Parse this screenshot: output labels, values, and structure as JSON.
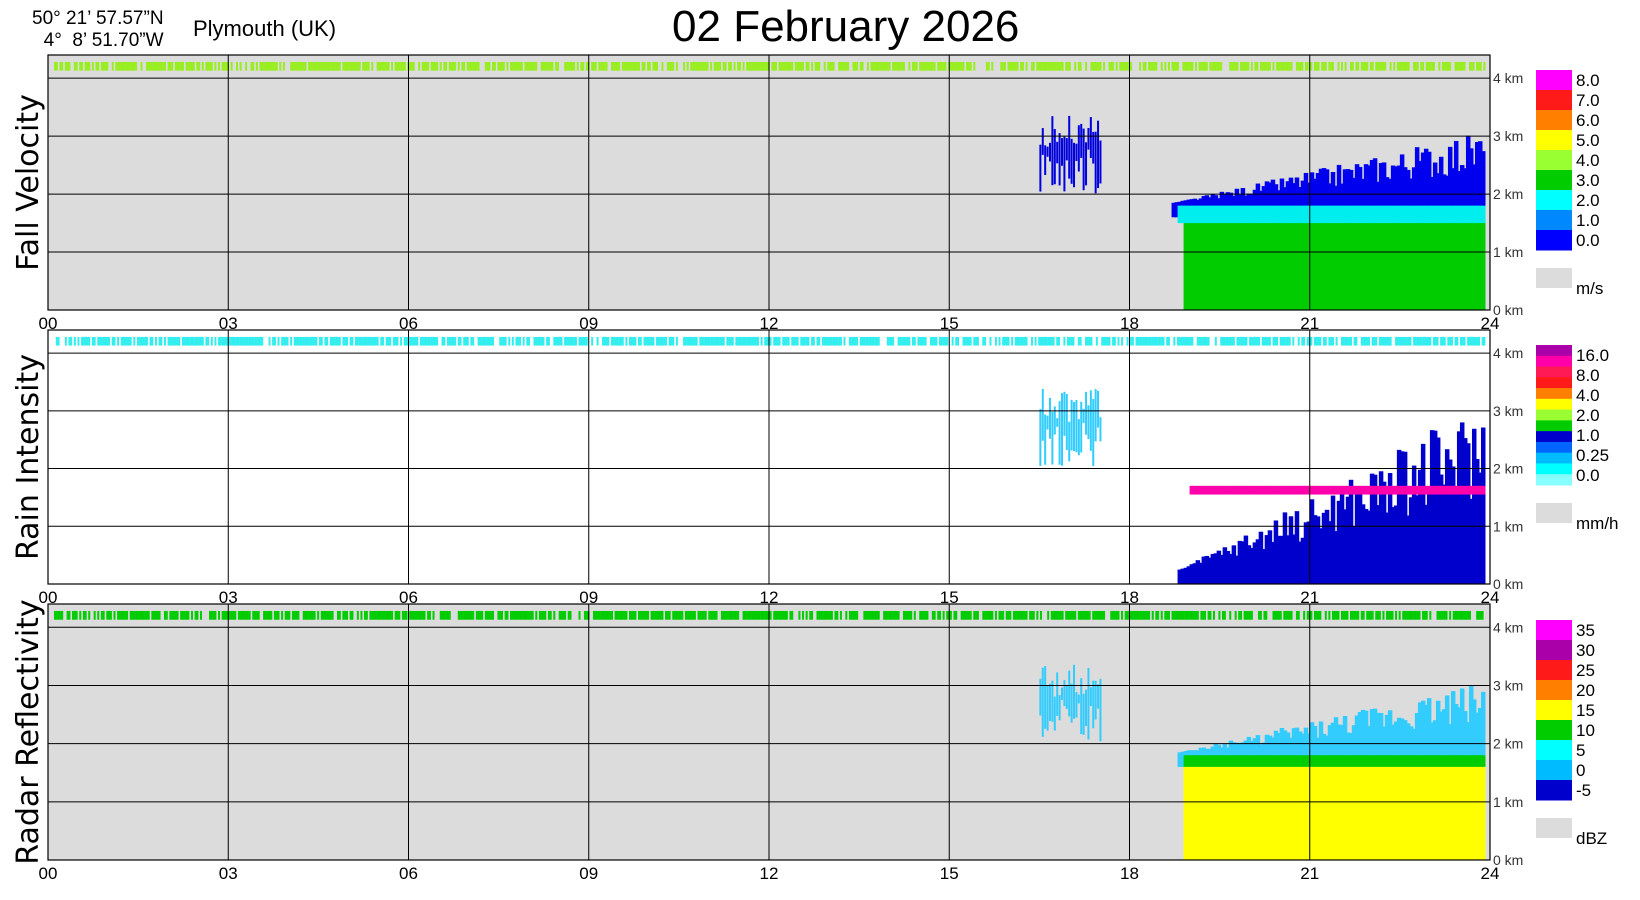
{
  "header": {
    "lat": "50° 21’ 57.57”N",
    "lon": "4°  8’ 51.70”W",
    "location": "Plymouth (UK)",
    "date_day": "02",
    "date_month": "February",
    "date_year": "2026"
  },
  "colors": {
    "panel_bg": "#dcdcdc",
    "rain_bg": "#ffffff",
    "grid": "#000000"
  },
  "chart_data": [
    {
      "type": "heatmap",
      "title": "Fall Velocity",
      "unit": "m/s",
      "x_ticks": [
        "00",
        "03",
        "06",
        "09",
        "12",
        "15",
        "18",
        "21",
        "24"
      ],
      "x_range": [
        0,
        24
      ],
      "y_ticks": [
        "4 km",
        "3 km",
        "2 km",
        "1 km",
        "0 km"
      ],
      "y_range": [
        0,
        4.4
      ],
      "colorbar": {
        "labels": [
          "8.0",
          "7.0",
          "6.0",
          "5.0",
          "4.0",
          "3.0",
          "2.0",
          "1.0",
          "0.0"
        ],
        "colors": [
          "#ff00ff",
          "#ff1a1a",
          "#ff8000",
          "#ffff00",
          "#99ff33",
          "#00cc00",
          "#00ffff",
          "#0088ff",
          "#0000ff"
        ]
      },
      "features": [
        {
          "name": "upper noise band",
          "x": [
            0.1,
            23.9
          ],
          "y": [
            4.13,
            4.28
          ],
          "color": "#99ee22"
        },
        {
          "name": "precip ice",
          "x": [
            18.7,
            23.9
          ],
          "y": [
            1.6,
            2.9
          ],
          "color": "#0000ee"
        },
        {
          "name": "rain",
          "x": [
            18.9,
            23.9
          ],
          "y": [
            0,
            1.6
          ],
          "color": "#00cc00"
        },
        {
          "name": "melting layer",
          "x": [
            18.8,
            23.9
          ],
          "y": [
            1.5,
            1.8
          ],
          "color": "#00eeee"
        },
        {
          "name": "virga",
          "x": [
            16.5,
            17.5
          ],
          "y": [
            2.0,
            3.4
          ],
          "color": "#0000dd"
        }
      ]
    },
    {
      "type": "heatmap",
      "title": "Rain Intensity",
      "unit": "mm/h",
      "x_ticks": [
        "00",
        "03",
        "06",
        "09",
        "12",
        "15",
        "18",
        "21",
        "24"
      ],
      "x_range": [
        0,
        24
      ],
      "y_ticks": [
        "4 km",
        "3 km",
        "2 km",
        "1 km",
        "0 km"
      ],
      "y_range": [
        0,
        4.4
      ],
      "colorbar": {
        "labels": [
          "16.0",
          "8.0",
          "4.0",
          "2.0",
          "1.0",
          "0.25",
          "0.0"
        ],
        "colors": [
          "#aa00aa",
          "#ff00aa",
          "#ff1a55",
          "#ff1a1a",
          "#ff8000",
          "#ffff00",
          "#99ff33",
          "#00cc00",
          "#0000cc",
          "#0066ff",
          "#00bbff",
          "#00ffff",
          "#88ffff"
        ]
      },
      "features": [
        {
          "name": "upper noise band",
          "x": [
            0.1,
            23.9
          ],
          "y": [
            4.13,
            4.28
          ],
          "color": "#33eeee"
        },
        {
          "name": "precip",
          "x": [
            18.8,
            23.9
          ],
          "y": [
            0,
            2.7
          ],
          "color": "#0000cc"
        },
        {
          "name": "bright band",
          "x": [
            19,
            23.9
          ],
          "y": [
            1.55,
            1.7
          ],
          "color": "#ff00aa"
        },
        {
          "name": "virga",
          "x": [
            16.5,
            17.5
          ],
          "y": [
            2.0,
            3.4
          ],
          "color": "#33ccff"
        }
      ]
    },
    {
      "type": "heatmap",
      "title": "Radar Reflectivity",
      "unit": "dBZ",
      "x_ticks": [
        "00",
        "03",
        "06",
        "09",
        "12",
        "15",
        "18",
        "21",
        "24"
      ],
      "x_range": [
        0,
        24
      ],
      "y_ticks": [
        "4 km",
        "3 km",
        "2 km",
        "1 km",
        "0 km"
      ],
      "y_range": [
        0,
        4.4
      ],
      "colorbar": {
        "labels": [
          "35",
          "30",
          "25",
          "20",
          "15",
          "10",
          "5",
          "0",
          "-5"
        ],
        "colors": [
          "#ff00ff",
          "#aa00aa",
          "#ff1a1a",
          "#ff8000",
          "#ffff00",
          "#00cc00",
          "#00ffff",
          "#00bbff",
          "#0000cc"
        ]
      },
      "features": [
        {
          "name": "upper noise band",
          "x": [
            0.1,
            23.9
          ],
          "y": [
            4.13,
            4.28
          ],
          "color": "#00cc00"
        },
        {
          "name": "precip ice",
          "x": [
            18.8,
            23.9
          ],
          "y": [
            1.6,
            2.9
          ],
          "color": "#33ccff"
        },
        {
          "name": "melting layer",
          "x": [
            18.9,
            23.9
          ],
          "y": [
            1.6,
            1.8
          ],
          "color": "#00cc00"
        },
        {
          "name": "rain",
          "x": [
            18.9,
            23.9
          ],
          "y": [
            0,
            1.6
          ],
          "color": "#ffff00"
        },
        {
          "name": "virga",
          "x": [
            16.5,
            17.5
          ],
          "y": [
            2.0,
            3.4
          ],
          "color": "#33ccff"
        }
      ]
    }
  ]
}
